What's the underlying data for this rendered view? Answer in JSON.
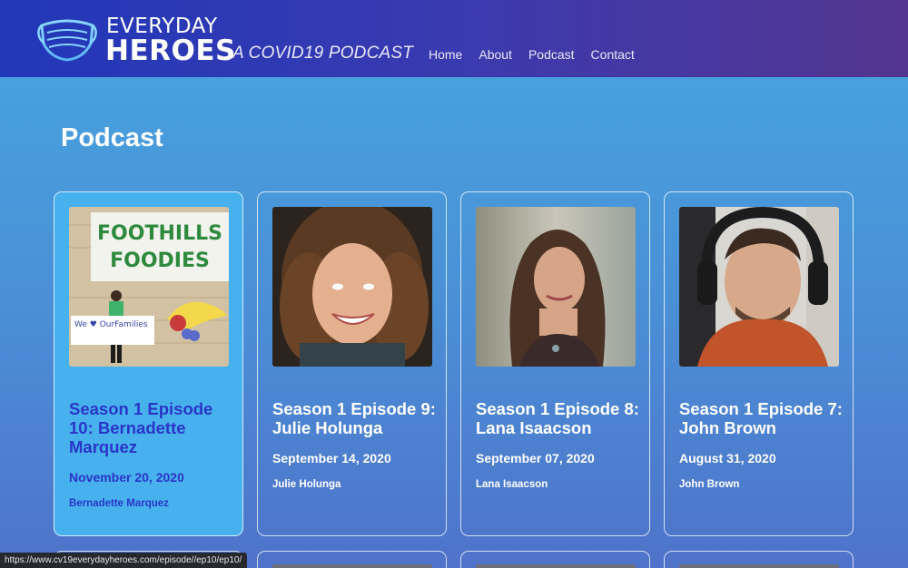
{
  "header": {
    "brand_top": "EVERYDAY",
    "brand_bottom": "HEROES",
    "tagline": "A COVID19 PODCAST",
    "nav": [
      "Home",
      "About",
      "Podcast",
      "Contact"
    ]
  },
  "page": {
    "title": "Podcast"
  },
  "episodes": [
    {
      "title": "Season 1 Episode 10: Bernadette Marquez",
      "date": "November 20, 2020",
      "guest": "Bernadette Marquez",
      "banner_line1": "FOOTHILLS",
      "banner_line2": "FOODIES",
      "sign_text": "We ♥ OurFamilies"
    },
    {
      "title": "Season 1 Episode 9: Julie Holunga",
      "date": "September 14, 2020",
      "guest": "Julie Holunga"
    },
    {
      "title": "Season 1 Episode 8: Lana Isaacson",
      "date": "September 07, 2020",
      "guest": "Lana Isaacson"
    },
    {
      "title": "Season 1 Episode 7: John Brown",
      "date": "August 31, 2020",
      "guest": "John Brown"
    }
  ],
  "status_bar": {
    "url": "https://www.cv19everydayheroes.com/episode//ep10/ep10/"
  },
  "colors": {
    "header_start": "#2138b9",
    "header_end": "#53358f",
    "active_card": "#47b1ee",
    "active_text": "#2a35c8"
  }
}
